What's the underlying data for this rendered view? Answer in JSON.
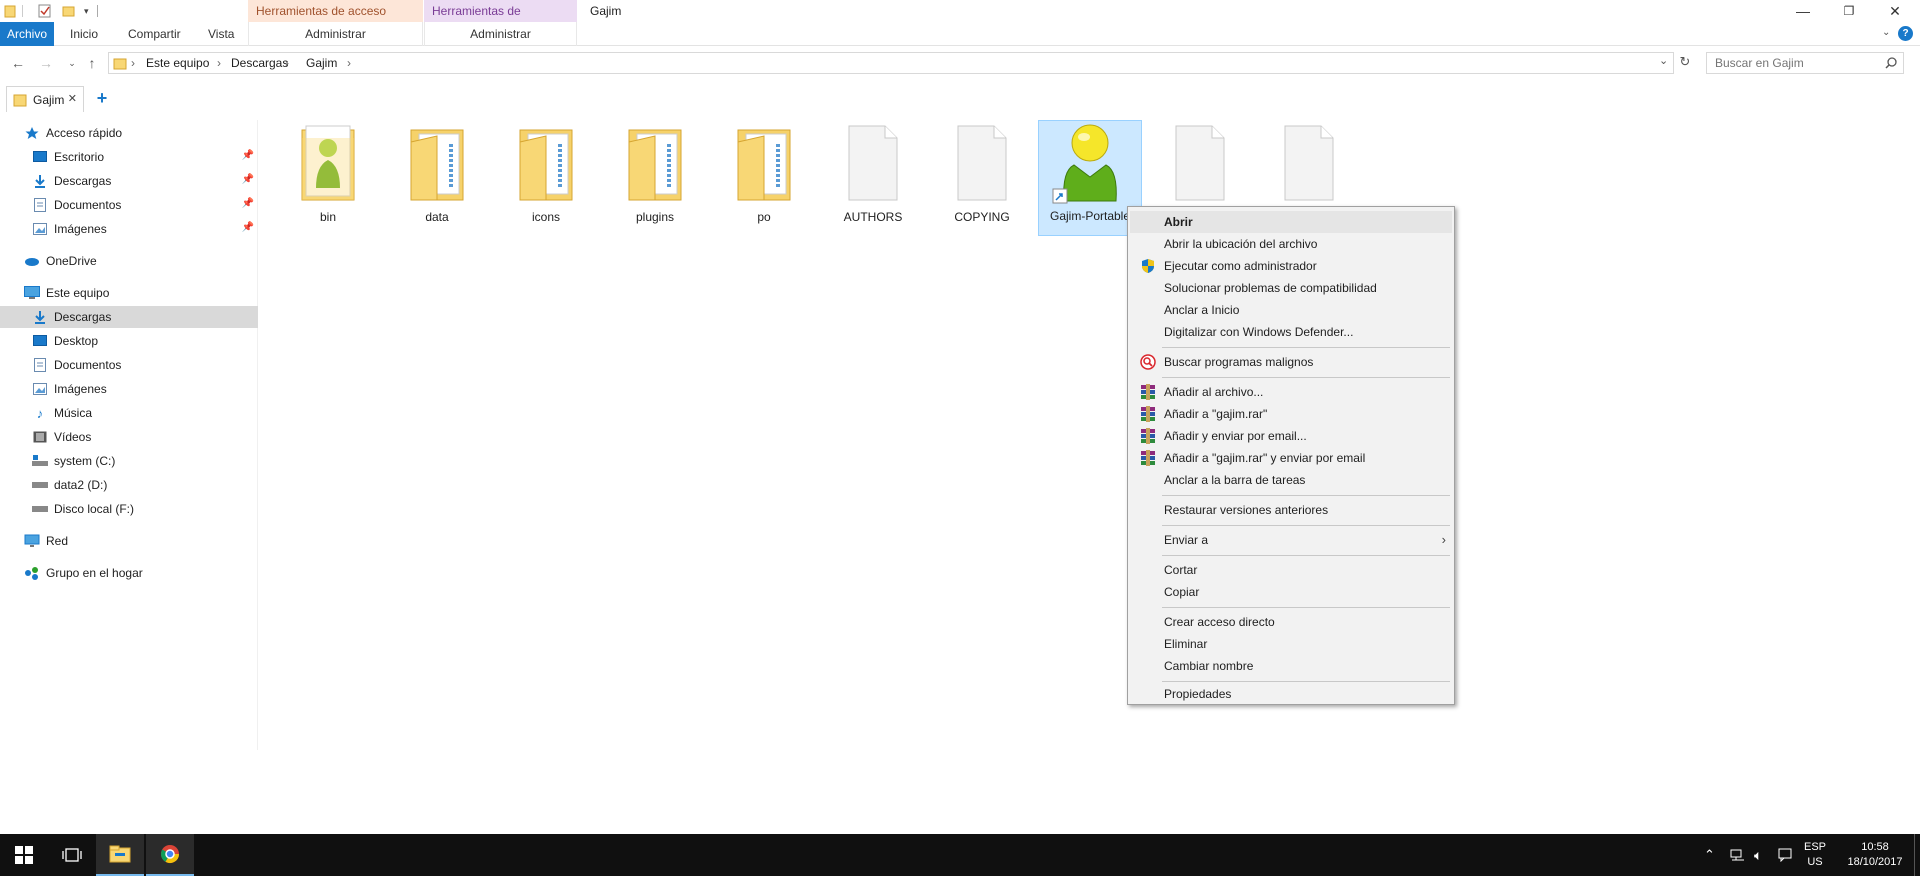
{
  "window": {
    "title": "Gajim",
    "contextual_tabs": [
      {
        "label": "Herramientas de acceso directo",
        "sub": "Administrar",
        "color": "#fde6d8"
      },
      {
        "label": "Herramientas de aplicación",
        "sub": "Administrar",
        "color": "#ecdcf3"
      }
    ]
  },
  "ribbon": {
    "tabs": [
      "Archivo",
      "Inicio",
      "Compartir",
      "Vista"
    ]
  },
  "address": {
    "crumbs": [
      "Este equipo",
      "Descargas",
      "Gajim"
    ],
    "search_placeholder": "Buscar en Gajim"
  },
  "tab": {
    "label": "Gajim"
  },
  "sidebar": {
    "quick_access": "Acceso rápido",
    "quick_items": [
      "Escritorio",
      "Descargas",
      "Documentos",
      "Imágenes"
    ],
    "onedrive": "OneDrive",
    "this_pc": "Este equipo",
    "pc_items": [
      "Descargas",
      "Desktop",
      "Documentos",
      "Imágenes",
      "Música",
      "Vídeos",
      "system (C:)",
      "data2 (D:)",
      "Disco local (F:)"
    ],
    "network": "Red",
    "homegroup": "Grupo en el hogar",
    "selected": "Descargas"
  },
  "files": [
    {
      "name": "bin",
      "kind": "folder-gajim"
    },
    {
      "name": "data",
      "kind": "folder"
    },
    {
      "name": "icons",
      "kind": "folder"
    },
    {
      "name": "plugins",
      "kind": "folder"
    },
    {
      "name": "po",
      "kind": "folder"
    },
    {
      "name": "AUTHORS",
      "kind": "file"
    },
    {
      "name": "COPYING",
      "kind": "file"
    },
    {
      "name": "Gajim-Portable",
      "kind": "shortcut-selected"
    },
    {
      "name": "",
      "kind": "file"
    },
    {
      "name": "",
      "kind": "file"
    }
  ],
  "context_menu": {
    "items": [
      {
        "label": "Abrir",
        "bold": true,
        "icon": ""
      },
      {
        "label": "Abrir la ubicación del archivo",
        "icon": ""
      },
      {
        "label": "Ejecutar como administrador",
        "icon": "uac-shield-icon"
      },
      {
        "label": "Solucionar problemas de compatibilidad",
        "icon": ""
      },
      {
        "label": "Anclar a Inicio",
        "icon": ""
      },
      {
        "label": "Digitalizar con Windows Defender...",
        "icon": ""
      },
      {
        "sep": true
      },
      {
        "label": "Buscar programas malignos",
        "icon": "malware-search-icon"
      },
      {
        "sep": true
      },
      {
        "label": "Añadir al archivo...",
        "icon": "winrar-icon"
      },
      {
        "label": "Añadir a \"gajim.rar\"",
        "icon": "winrar-icon"
      },
      {
        "label": "Añadir y enviar por email...",
        "icon": "winrar-icon"
      },
      {
        "label": "Añadir a \"gajim.rar\" y enviar por email",
        "icon": "winrar-icon"
      },
      {
        "label": "Anclar a la barra de tareas",
        "icon": ""
      },
      {
        "sep": true
      },
      {
        "label": "Restaurar versiones anteriores",
        "icon": ""
      },
      {
        "sep": true
      },
      {
        "label": "Enviar a",
        "icon": "",
        "submenu": true
      },
      {
        "sep": true
      },
      {
        "label": "Cortar",
        "icon": ""
      },
      {
        "label": "Copiar",
        "icon": ""
      },
      {
        "sep": true
      },
      {
        "label": "Crear acceso directo",
        "icon": ""
      },
      {
        "label": "Eliminar",
        "icon": ""
      },
      {
        "label": "Cambiar nombre",
        "icon": ""
      },
      {
        "sep": true
      },
      {
        "label": "Propiedades",
        "icon": ""
      }
    ]
  },
  "taskbar": {
    "lang": "ESP",
    "layout": "US",
    "time": "10:58",
    "date": "18/10/2017"
  },
  "colors": {
    "accent": "#1979ca",
    "folder": "#f8d775",
    "selection": "#cce8ff"
  }
}
